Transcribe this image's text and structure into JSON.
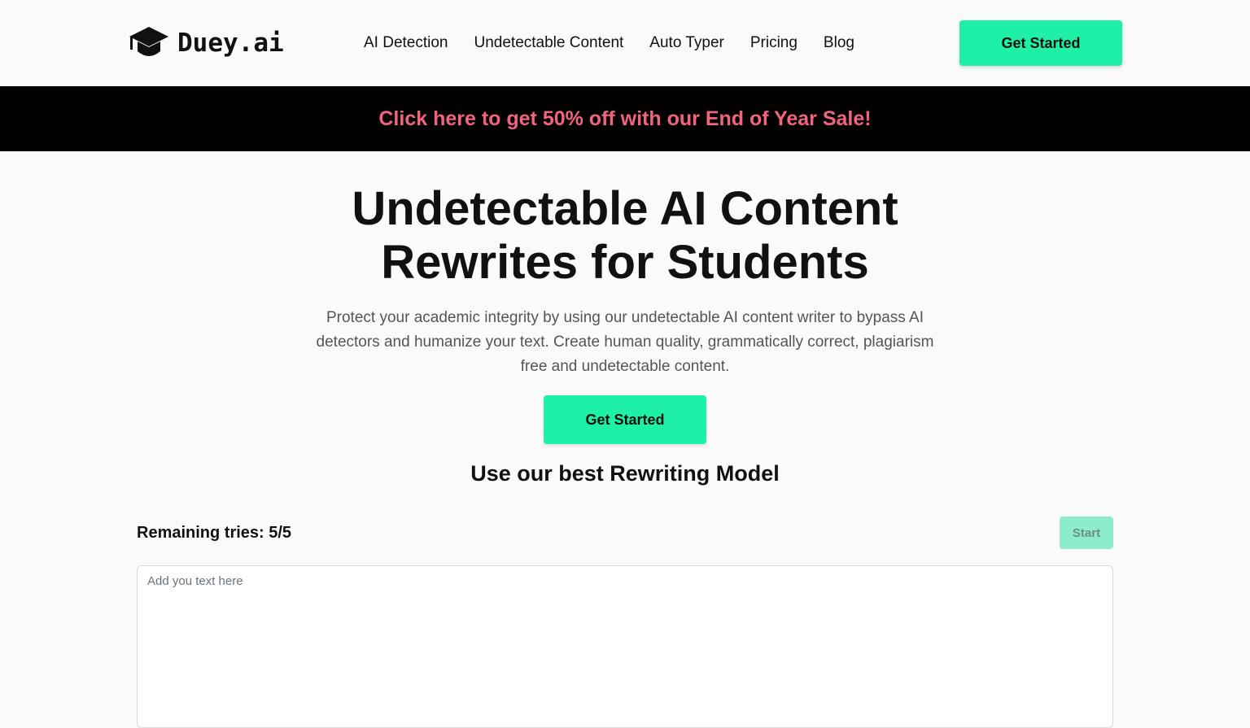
{
  "header": {
    "logo_text": "Duey.ai",
    "logo_icon": "graduation-cap-icon",
    "nav": [
      {
        "label": "AI Detection"
      },
      {
        "label": "Undetectable Content"
      },
      {
        "label": "Auto Typer"
      },
      {
        "label": "Pricing"
      },
      {
        "label": "Blog"
      }
    ],
    "cta_label": "Get Started"
  },
  "promo": {
    "text": "Click here to get 50% off with our End of Year Sale!",
    "text_color": "#f2637e",
    "background": "#000000"
  },
  "hero": {
    "title": "Undetectable AI Content Rewrites for Students",
    "subtitle": "Protect your academic integrity by using our undetectable AI content writer to bypass AI detectors and humanize your text. Create human quality, grammatically correct, plagiarism free and undetectable content.",
    "cta_label": "Get Started"
  },
  "tool": {
    "section_title": "Use our best Rewriting Model",
    "remaining_label": "Remaining tries: 5/5",
    "start_label": "Start",
    "start_disabled": true,
    "input_placeholder": "Add you text here",
    "input_value": ""
  },
  "colors": {
    "accent": "#1ff0a7",
    "accent_disabled": "#8ceccb",
    "page_background": "#fafafa",
    "text": "#111111",
    "muted_text": "#555555"
  }
}
